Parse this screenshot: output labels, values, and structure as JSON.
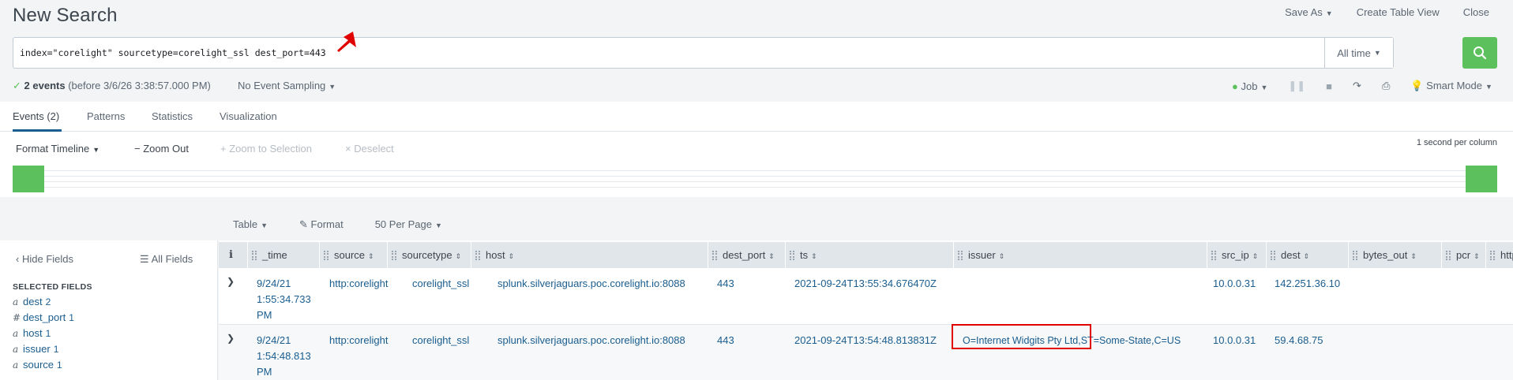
{
  "header": {
    "title": "New Search",
    "save_as": "Save As",
    "create_table_view": "Create Table View",
    "close": "Close"
  },
  "search": {
    "query": "index=\"corelight\" sourcetype=corelight_ssl dest_port=443",
    "time_range": "All time"
  },
  "status": {
    "event_count": "2 events",
    "before": "(before 3/6/26 3:38:57.000 PM)",
    "sampling": "No Event Sampling",
    "job": "Job",
    "mode": "Smart Mode"
  },
  "tabs": [
    {
      "label": "Events (2)"
    },
    {
      "label": "Patterns"
    },
    {
      "label": "Statistics"
    },
    {
      "label": "Visualization"
    }
  ],
  "timeline": {
    "format": "Format Timeline",
    "zoom_out": "Zoom Out",
    "zoom_selection": "Zoom to Selection",
    "deselect": "Deselect",
    "scale": "1 second per column"
  },
  "table_tools": {
    "view": "Table",
    "format": "Format",
    "per_page": "50 Per Page"
  },
  "sidebar": {
    "hide_fields": "Hide Fields",
    "all_fields": "All Fields",
    "selected_header": "SELECTED FIELDS",
    "fields": [
      {
        "type": "a",
        "name": "dest",
        "count": "2"
      },
      {
        "type": "#",
        "name": "dest_port",
        "count": "1"
      },
      {
        "type": "a",
        "name": "host",
        "count": "1"
      },
      {
        "type": "a",
        "name": "issuer",
        "count": "1"
      },
      {
        "type": "a",
        "name": "source",
        "count": "1"
      }
    ]
  },
  "table": {
    "columns": [
      "i",
      "_time",
      "source",
      "sourcetype",
      "host",
      "dest_port",
      "ts",
      "issuer",
      "src_ip",
      "dest",
      "bytes_out",
      "pcr",
      "http_"
    ],
    "rows": [
      {
        "time": "9/24/21 1:55:34.733 PM",
        "source": "http:corelight",
        "sourcetype": "corelight_ssl",
        "host": "splunk.silverjaguars.poc.corelight.io:8088",
        "dest_port": "443",
        "ts": "2021-09-24T13:55:34.676470Z",
        "issuer": "",
        "src_ip": "10.0.0.31",
        "dest": "142.251.36.10"
      },
      {
        "time": "9/24/21 1:54:48.813 PM",
        "source": "http:corelight",
        "sourcetype": "corelight_ssl",
        "host": "splunk.silverjaguars.poc.corelight.io:8088",
        "dest_port": "443",
        "ts": "2021-09-24T13:54:48.813831Z",
        "issuer": "O=Internet Widgits Pty Ltd,ST=Some-State,C=US",
        "src_ip": "10.0.0.31",
        "dest": "59.4.68.75"
      }
    ]
  },
  "colors": {
    "accent_green": "#5cc05c",
    "link_blue": "#1a5d8f",
    "annotation_red": "#e00000"
  }
}
